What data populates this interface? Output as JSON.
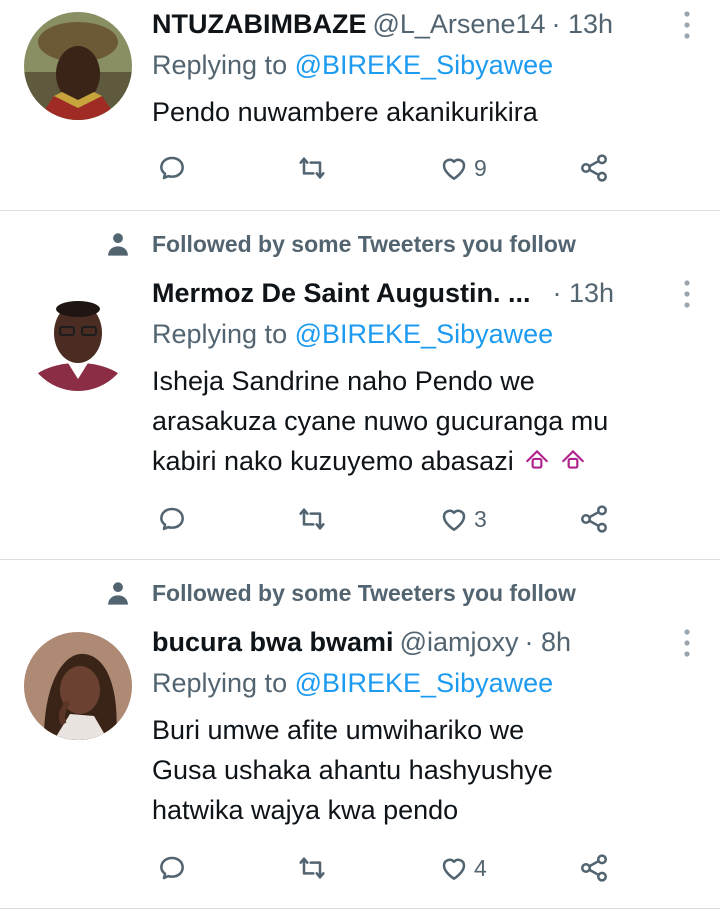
{
  "tweets": [
    {
      "name": "NTUZABIMBAZE",
      "handle": "@L_Arsene14",
      "time": "· 13h",
      "reply_prefix": "Replying to",
      "reply_to": "@BIREKE_Sibyawee",
      "text_lines": [
        "Pendo nuwambere akanikurikira"
      ],
      "likes": "9"
    },
    {
      "social_context": "Followed by some Tweeters you follow",
      "name": "Mermoz De Saint Augustin. ...",
      "time": "· 13h",
      "reply_prefix": "Replying to",
      "reply_to": "@BIREKE_Sibyawee",
      "text_lines": [
        "Isheja Sandrine naho Pendo we",
        "arasakuza cyane nuwo gucuranga mu",
        "kabiri nako kuzuyemo abasazi"
      ],
      "likes": "3"
    },
    {
      "social_context": "Followed by some Tweeters you follow",
      "name": "bucura bwa bwami",
      "handle": "@iamjoxy",
      "time": "· 8h",
      "reply_prefix": "Replying to",
      "reply_to": "@BIREKE_Sibyawee",
      "text_lines": [
        "Buri umwe afite umwihariko we",
        "Gusa ushaka ahantu hashyushye",
        "hatwika wajya kwa pendo"
      ],
      "likes": "4"
    }
  ],
  "colors": {
    "text": "#0f1419",
    "muted": "#536471",
    "link": "#1d9bf0",
    "divider": "#d9dee2"
  },
  "icons": [
    "reply-icon",
    "retweet-icon",
    "like-icon",
    "share-icon",
    "more-icon",
    "person-icon",
    "emoji-icon"
  ]
}
